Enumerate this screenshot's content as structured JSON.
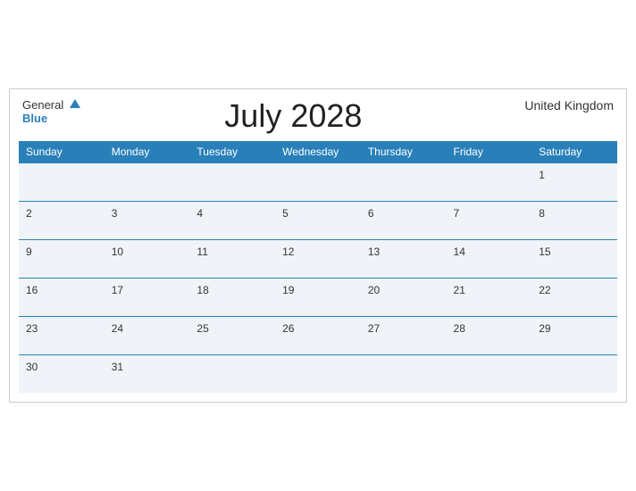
{
  "header": {
    "logo_general": "General",
    "logo_blue": "Blue",
    "title": "July 2028",
    "region": "United Kingdom"
  },
  "days_of_week": [
    "Sunday",
    "Monday",
    "Tuesday",
    "Wednesday",
    "Thursday",
    "Friday",
    "Saturday"
  ],
  "weeks": [
    [
      "",
      "",
      "",
      "",
      "",
      "",
      "1"
    ],
    [
      "2",
      "3",
      "4",
      "5",
      "6",
      "7",
      "8"
    ],
    [
      "9",
      "10",
      "11",
      "12",
      "13",
      "14",
      "15"
    ],
    [
      "16",
      "17",
      "18",
      "19",
      "20",
      "21",
      "22"
    ],
    [
      "23",
      "24",
      "25",
      "26",
      "27",
      "28",
      "29"
    ],
    [
      "30",
      "31",
      "",
      "",
      "",
      "",
      ""
    ]
  ]
}
